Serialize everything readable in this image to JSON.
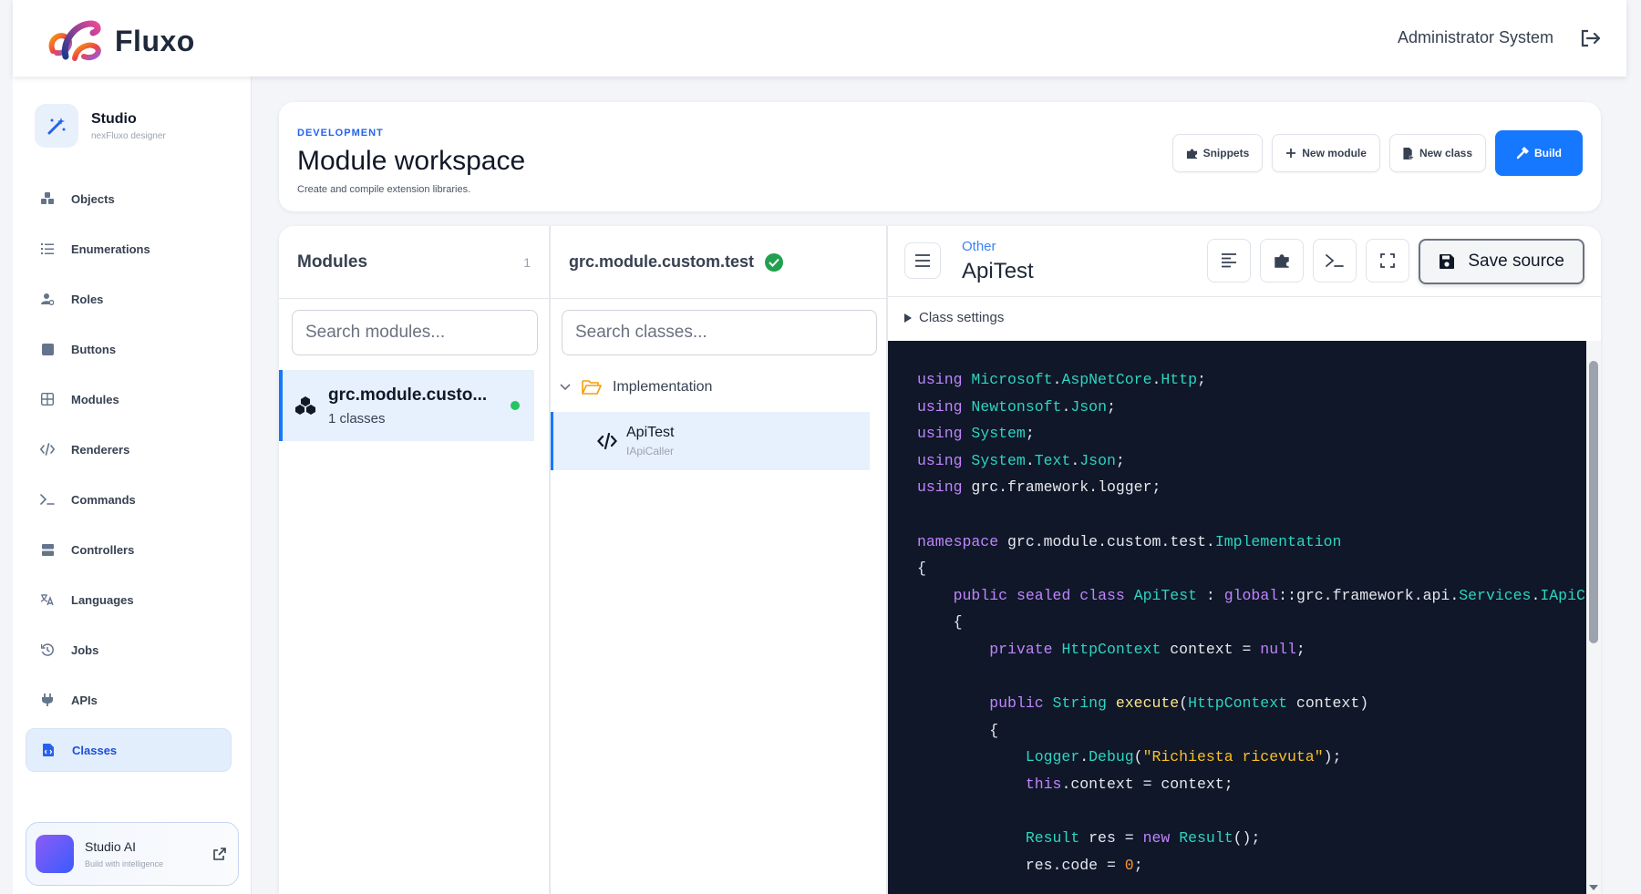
{
  "app": {
    "brand": "Fluxo",
    "user": "Administrator System"
  },
  "sidebar": {
    "studio_title": "Studio",
    "studio_subtitle": "nexFluxo designer",
    "items": [
      {
        "label": "Objects",
        "icon": "boxes-icon"
      },
      {
        "label": "Enumerations",
        "icon": "list-ol-icon"
      },
      {
        "label": "Roles",
        "icon": "user-gear-icon"
      },
      {
        "label": "Buttons",
        "icon": "square-icon"
      },
      {
        "label": "Modules",
        "icon": "grid-icon"
      },
      {
        "label": "Renderers",
        "icon": "code-icon"
      },
      {
        "label": "Commands",
        "icon": "terminal-icon"
      },
      {
        "label": "Controllers",
        "icon": "server-icon"
      },
      {
        "label": "Languages",
        "icon": "language-icon"
      },
      {
        "label": "Jobs",
        "icon": "history-icon"
      },
      {
        "label": "APIs",
        "icon": "plug-icon"
      },
      {
        "label": "Classes",
        "icon": "file-code-icon",
        "active": true
      }
    ],
    "ai_title": "Studio AI",
    "ai_subtitle": "Build with intelligence"
  },
  "header": {
    "kicker": "DEVELOPMENT",
    "title": "Module workspace",
    "subtitle": "Create and compile extension libraries.",
    "buttons": {
      "snippets": "Snippets",
      "new_module": "New module",
      "new_class": "New class",
      "build": "Build"
    }
  },
  "modules": {
    "title": "Modules",
    "count": "1",
    "search_placeholder": "Search modules...",
    "items": [
      {
        "name": "grc.module.custo...",
        "classes": "1 classes"
      }
    ]
  },
  "classes": {
    "title": "grc.module.custom.test",
    "search_placeholder": "Search classes...",
    "folder": "Implementation",
    "items": [
      {
        "name": "ApiTest",
        "interface": "IApiCaller"
      }
    ]
  },
  "editor": {
    "kicker": "Other",
    "title": "ApiTest",
    "save_label": "Save source",
    "settings_label": "Class settings",
    "code_lines": [
      "using Microsoft.AspNetCore.Http;",
      "using Newtonsoft.Json;",
      "using System;",
      "using System.Text.Json;",
      "using grc.framework.logger;",
      "",
      "namespace grc.module.custom.test.Implementation",
      "{",
      "    public sealed class ApiTest : global::grc.framework.api.Services.IApiC",
      "    {",
      "        private HttpContext context = null;",
      "",
      "        public String execute(HttpContext context)",
      "        {",
      "            Logger.Debug(\"Richiesta ricevuta\");",
      "            this.context = context;",
      "",
      "            Result res = new Result();",
      "            res.code = 0;"
    ]
  },
  "colors": {
    "accent": "#1677ff",
    "code_bg": "#0f1729",
    "status_ok": "#22c55e"
  }
}
